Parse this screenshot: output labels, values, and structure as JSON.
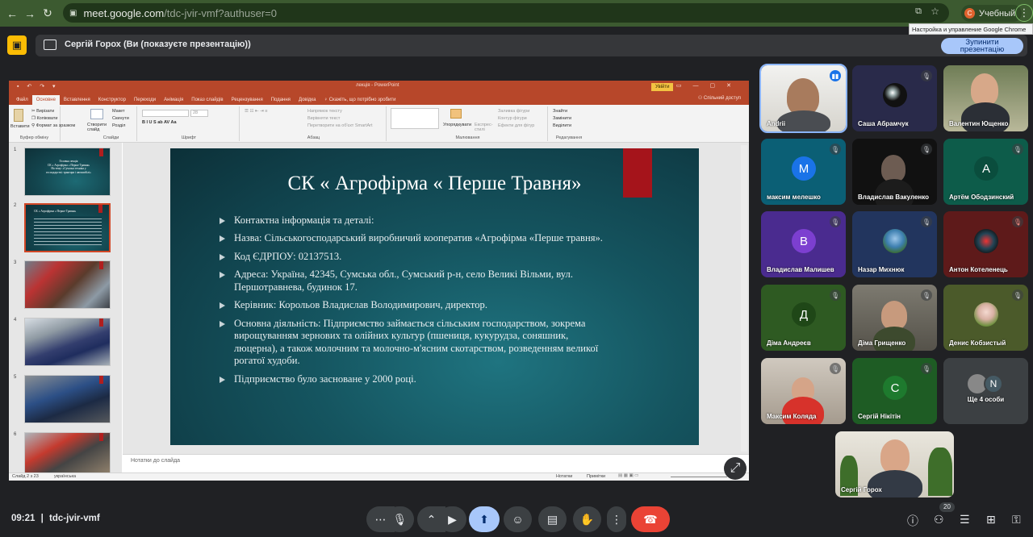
{
  "browser": {
    "url_host": "meet.google.com",
    "url_path": "/tdc-jvir-vmf?authuser=0",
    "profile_label": "Учебный",
    "profile_initial": "C",
    "tooltip": "Настройка и управление Google Chrome"
  },
  "meet": {
    "presenter_banner": "Сергій Горох (Ви (показуєте презентацію))",
    "stop_button_line1": "Зупинити",
    "stop_button_line2": "презентацію",
    "time": "09:21",
    "separator": "|",
    "meeting_code": "tdc-jvir-vmf",
    "participants_count": "20"
  },
  "powerpoint": {
    "doc_title": "лекція  -  PowerPoint",
    "sign_in": "Увійти",
    "tabs": [
      "Файл",
      "Основне",
      "Вставлення",
      "Конструктор",
      "Переходи",
      "Анімація",
      "Показ слайдів",
      "Рецензування",
      "Подання",
      "Довідка",
      "Скажіть, що потрібно зробити"
    ],
    "share": "Спільний доступ",
    "ribbon": {
      "paste": "Вставити",
      "cut": "Вирізати",
      "copy": "Копіювати",
      "format_painter": "Формат за зразком",
      "clipboard": "Буфер обміну",
      "new_slide": "Створити слайд",
      "layout": "Макет",
      "reset": "Скинути",
      "section": "Розділ",
      "slides": "Слайди",
      "font": "Шрифт",
      "paragraph": "Абзац",
      "text_direction": "Напрямок тексту",
      "align_text": "Вирівняти текст",
      "convert_smartart": "Перетворити на об'єкт SmartArt",
      "arrange": "Упорядкувати",
      "quick_styles": "Експрес-стилі",
      "shape_fill": "Заливка фігури",
      "shape_outline": "Контур фігури",
      "shape_effects": "Ефекти для фігур",
      "drawing": "Малювання",
      "find": "Знайти",
      "replace": "Замінити",
      "select": "Виділити",
      "editing": "Редагування",
      "font_size": "28"
    },
    "thumbnails": [
      {
        "num": "1",
        "lines": [
          "Головна лекція",
          "СК « Агрофірма « Перше Травня»",
          "На тему: «Сучасна техніка у",
          "господарстві: трактори і автомобілі»"
        ]
      },
      {
        "num": "2",
        "lines": [
          "СК « Агрофірма « Перше Травня»"
        ]
      },
      {
        "num": "3"
      },
      {
        "num": "4"
      },
      {
        "num": "5"
      },
      {
        "num": "6"
      }
    ],
    "notes_placeholder": "Нотатки до слайда",
    "status_slide": "Слайд 2 з 23",
    "status_lang": "українська",
    "status_notes": "Нотатки",
    "status_comments": "Примітки"
  },
  "slide": {
    "title": "СК « Агрофірма « Перше Травня»",
    "bullets": [
      "Контактна інформація та деталі:",
      "Назва: Сільськогосподарський виробничий кооператив «Агрофірма «Перше травня».",
      "Код ЄДРПОУ: 02137513.",
      "Адреса: Україна, 42345, Сумська обл., Сумський р-н, село Великі Вільми, вул. Першотравнева, будинок 17.",
      "Керівник: Корольов Владислав Володимирович, директор.",
      "Основна діяльність: Підприємство займається сільським господарством, зокрема вирощуванням зернових та олійних культур (пшениця, кукурудза, соняшник, люцерна), а також молочним та молочно-м'ясним скотарством, розведенням великої рогатої худоби.",
      "Підприємство було засноване у 2000 році."
    ]
  },
  "participants": [
    {
      "name": "Andrii",
      "type": "video"
    },
    {
      "name": "Саша Абрамчук",
      "type": "video"
    },
    {
      "name": "Валентин Ющенко",
      "type": "video"
    },
    {
      "name": "максим мелешко",
      "initial": "М",
      "color": "#1a73e8",
      "bg": "#0b5f75"
    },
    {
      "name": "Владислав Вакуленко",
      "type": "video"
    },
    {
      "name": "Артём Ободзинский",
      "initial": "А",
      "color": "#0d5c4a",
      "bg": "#0d5c4a"
    },
    {
      "name": "Владислав Малишев",
      "initial": "В",
      "color": "#7c3fd0",
      "bg": "#4a2b8f"
    },
    {
      "name": "Назар Михнюк",
      "type": "avatar-img"
    },
    {
      "name": "Антон Котеленець",
      "type": "avatar-img"
    },
    {
      "name": "Діма Андреєв",
      "initial": "Д",
      "color": "#2e6b26",
      "bg": "#2e5a22"
    },
    {
      "name": "Діма Грищенко",
      "type": "video"
    },
    {
      "name": "Денис Кобзистый",
      "type": "avatar-img"
    },
    {
      "name": "Максим Коляда",
      "type": "video"
    },
    {
      "name": "Сергій Нікітін",
      "initial": "С",
      "color": "#1e7a2e",
      "bg": "#1e5c24"
    },
    {
      "name": "Ще 4 особи",
      "type": "more",
      "initial": "N"
    },
    {
      "name": "Сергій Горох",
      "type": "self"
    }
  ],
  "colors": {
    "meet_bg": "#202124",
    "browser_bar": "#3c5a30",
    "ppt_accent": "#b7472a",
    "end_call": "#ea4335",
    "present_active": "#a8c7fa"
  }
}
